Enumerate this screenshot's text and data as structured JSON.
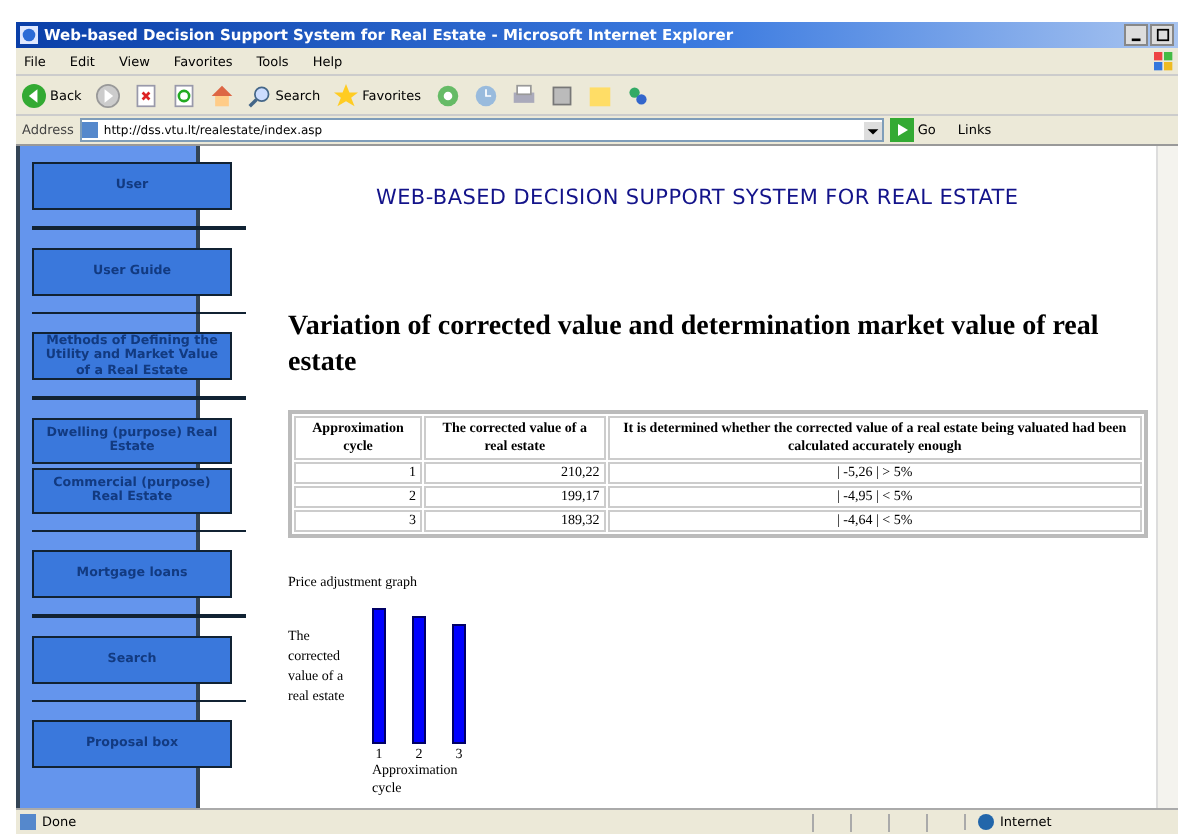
{
  "window": {
    "title": "Web-based Decision Support System for Real Estate - Microsoft Internet Explorer"
  },
  "menu": [
    "File",
    "Edit",
    "View",
    "Favorites",
    "Tools",
    "Help"
  ],
  "toolbar": {
    "back": "Back",
    "search": "Search",
    "favorites": "Favorites"
  },
  "address": {
    "label": "Address",
    "url": "http://dss.vtu.lt/realestate/index.asp",
    "go": "Go",
    "links": "Links"
  },
  "sidebar": {
    "groups": [
      {
        "items": [
          "User"
        ]
      },
      {
        "items": [
          "User Guide"
        ]
      },
      {
        "items": [
          "Methods of Defining the Utility and Market Value of a Real Estate"
        ]
      },
      {
        "items": [
          "Dwelling (purpose) Real Estate",
          "Commercial (purpose) Real Estate"
        ]
      },
      {
        "items": [
          "Mortgage loans"
        ]
      },
      {
        "items": [
          "Search"
        ]
      },
      {
        "items": [
          "Proposal box"
        ]
      }
    ]
  },
  "page": {
    "banner": "WEB-BASED DECISION SUPPORT SYSTEM FOR REAL ESTATE",
    "heading": "Variation of corrected value and determination market value of real estate"
  },
  "table": {
    "columns": [
      "Approximation cycle",
      "The corrected value of a real estate",
      "It is determined whether the corrected value of a real estate being valuated had been calculated accurately enough"
    ],
    "rows": [
      [
        "1",
        "210,22",
        "| -5,26 | > 5%"
      ],
      [
        "2",
        "199,17",
        "| -4,95 | < 5%"
      ],
      [
        "3",
        "189,32",
        "| -4,64 | < 5%"
      ]
    ]
  },
  "graph": {
    "title": "Price adjustment graph",
    "ylabel": "The corrected value of a real estate",
    "categories": [
      "1",
      "2",
      "3"
    ],
    "xlabel": "Approximation cycle"
  },
  "status_bar": {
    "text": "Done",
    "zone": "Internet"
  }
}
